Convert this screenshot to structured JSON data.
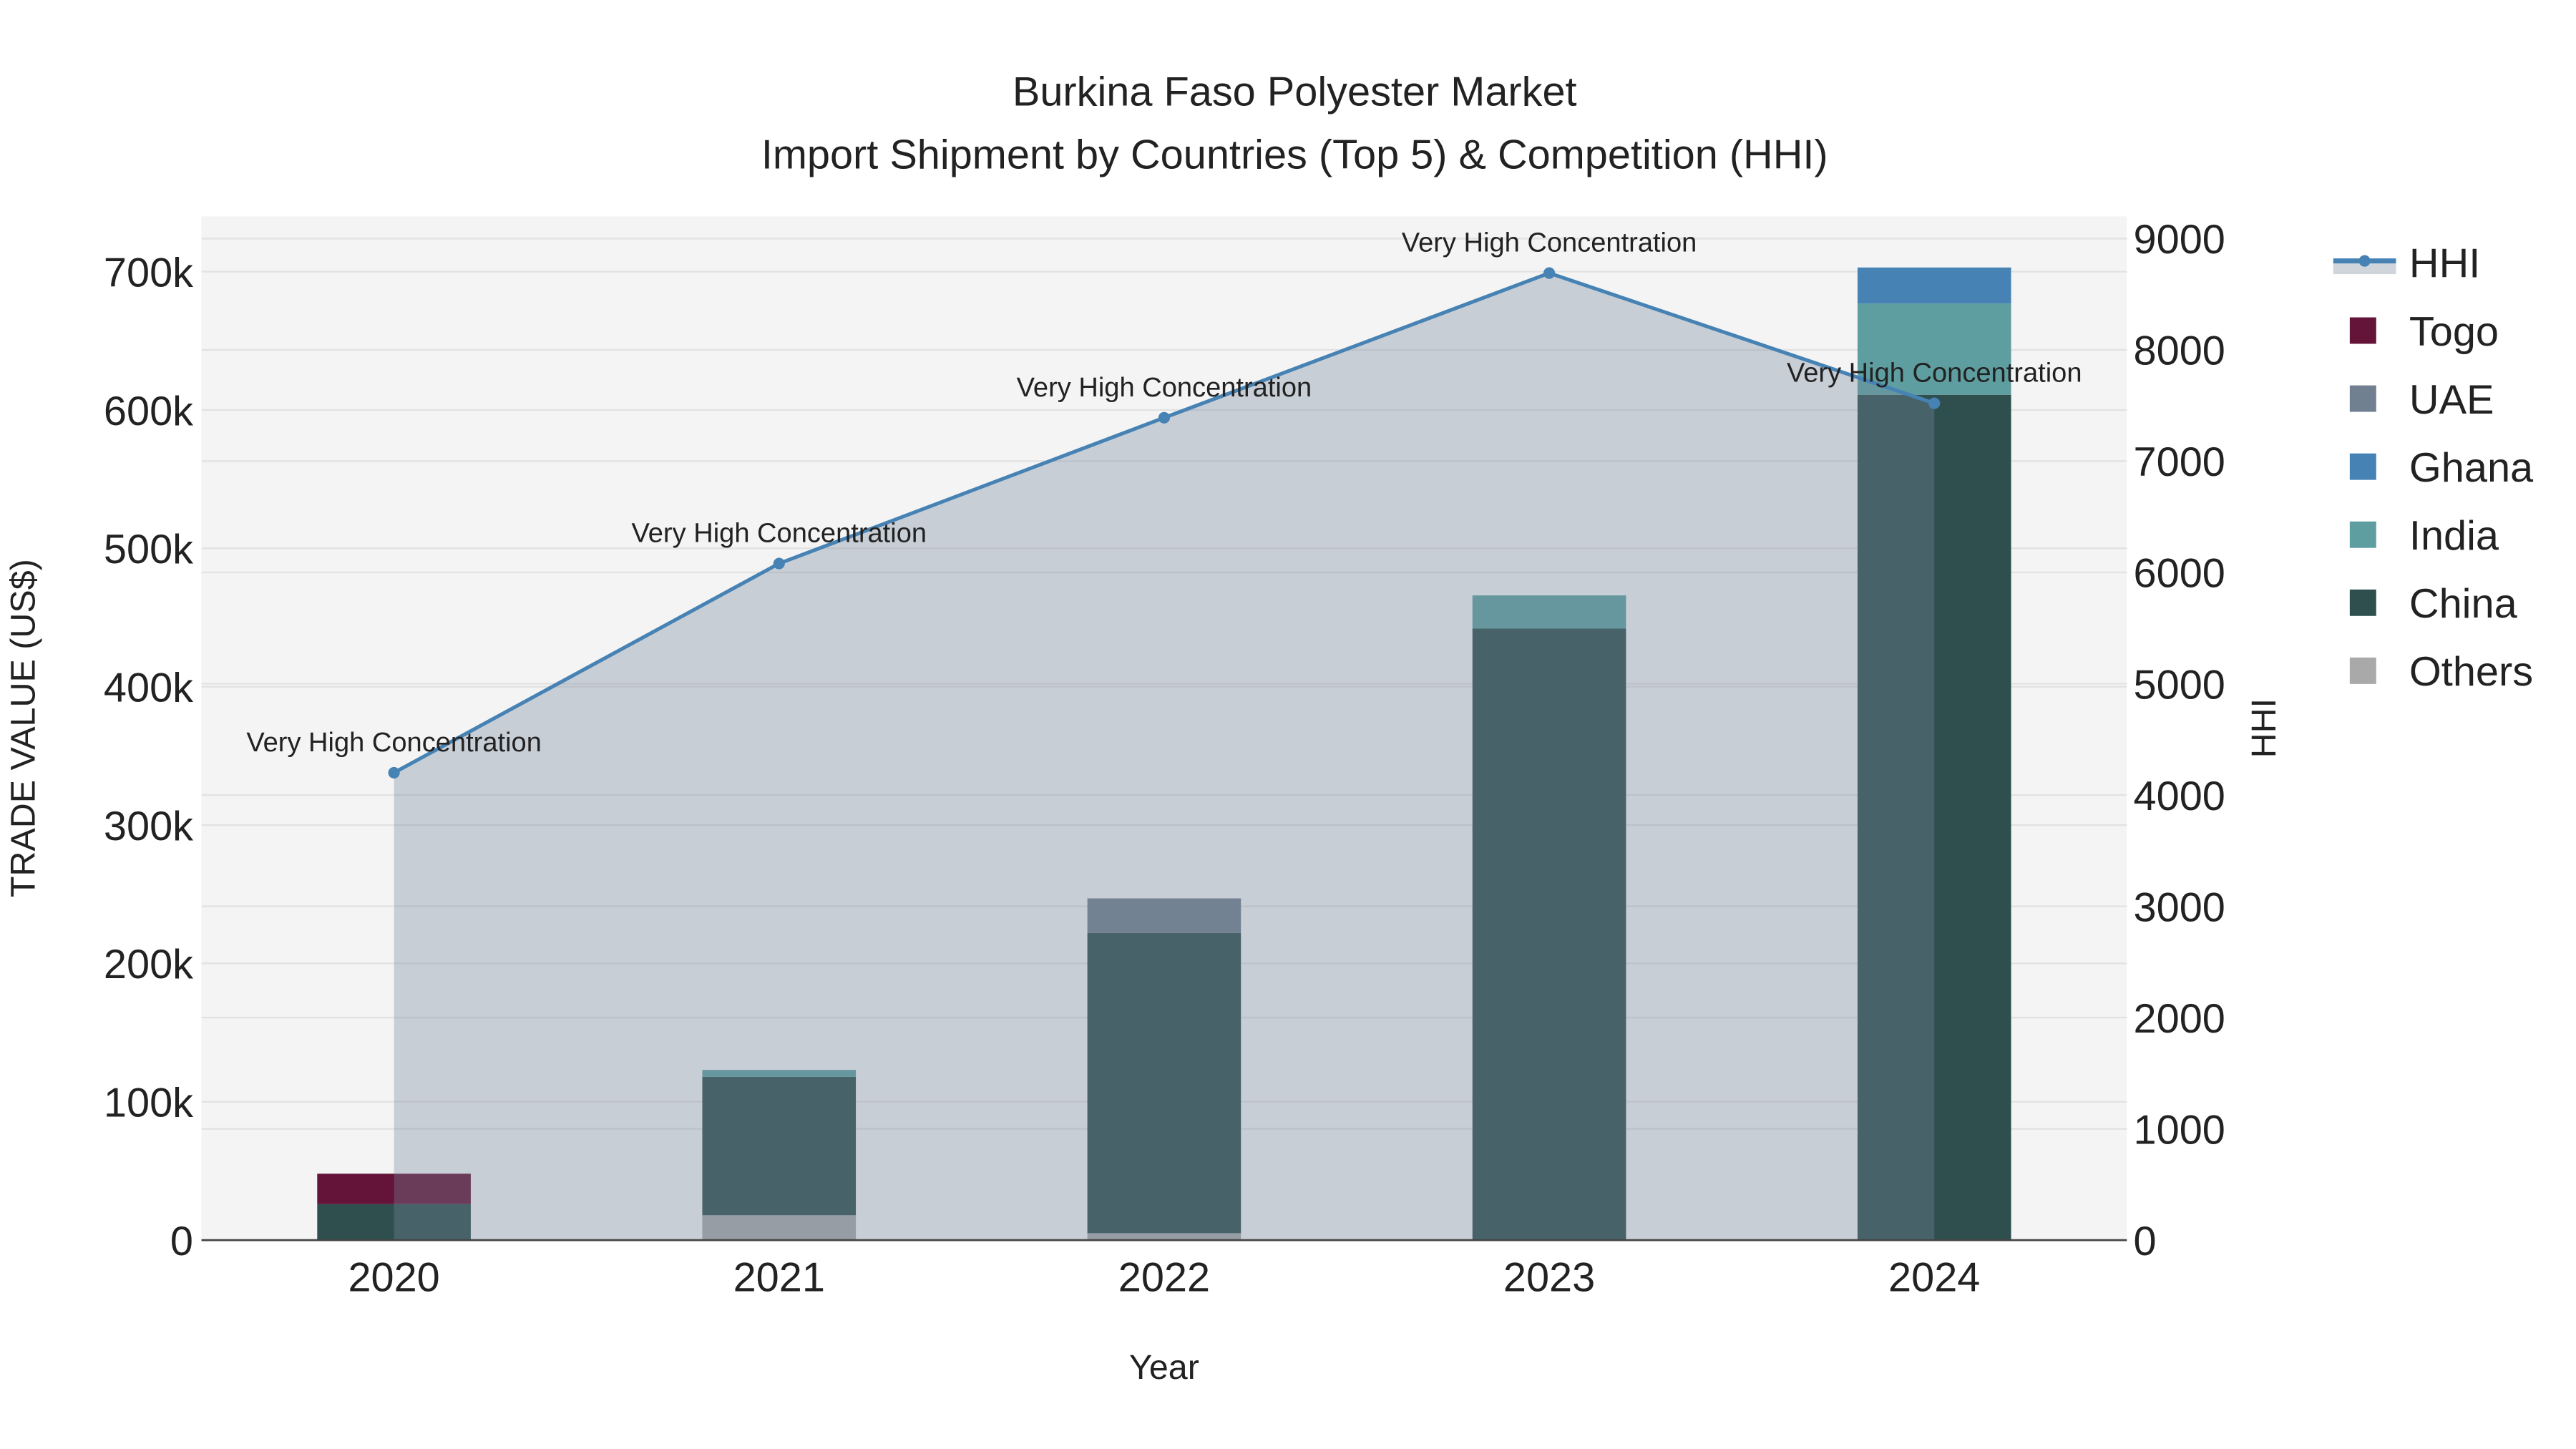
{
  "chart_data": {
    "type": "bar",
    "title": "Burkina Faso Polyester Market",
    "subtitle": "Import Shipment by Countries (Top 5) & Competition (HHI)",
    "xlabel": "Year",
    "ylabel": "TRADE VALUE (US$)",
    "y2label": "HHI",
    "categories": [
      "2020",
      "2021",
      "2022",
      "2023",
      "2024"
    ],
    "ylim": [
      0,
      740000
    ],
    "y2lim": [
      0,
      9200
    ],
    "yticks": [
      0,
      100000,
      200000,
      300000,
      400000,
      500000,
      600000,
      700000
    ],
    "ytick_labels": [
      "0",
      "100k",
      "200k",
      "300k",
      "400k",
      "500k",
      "600k",
      "700k"
    ],
    "y2ticks": [
      0,
      1000,
      2000,
      3000,
      4000,
      5000,
      6000,
      7000,
      8000,
      9000
    ],
    "y2tick_labels": [
      "0",
      "1000",
      "2000",
      "3000",
      "4000",
      "5000",
      "6000",
      "7000",
      "8000",
      "9000"
    ],
    "stacked": true,
    "series": [
      {
        "name": "Others",
        "color": "#a9a9a9",
        "values": [
          0,
          18000,
          5000,
          0,
          0
        ]
      },
      {
        "name": "China",
        "color": "#2f4f4f",
        "values": [
          26000,
          100000,
          217000,
          442000,
          611000
        ]
      },
      {
        "name": "India",
        "color": "#5f9ea0",
        "values": [
          0,
          5000,
          0,
          24000,
          66000
        ]
      },
      {
        "name": "Ghana",
        "color": "#4682b4",
        "values": [
          0,
          0,
          0,
          0,
          26000
        ]
      },
      {
        "name": "UAE",
        "color": "#708090",
        "values": [
          0,
          0,
          25000,
          0,
          0
        ]
      },
      {
        "name": "Togo",
        "color": "#641438",
        "values": [
          22000,
          0,
          0,
          0,
          0
        ]
      }
    ],
    "line": {
      "name": "HHI",
      "color": "#4682b4",
      "axis": "right",
      "values": [
        4200,
        6080,
        7390,
        8690,
        7520
      ],
      "annotations": [
        "Very High Concentration",
        "Very High Concentration",
        "Very High Concentration",
        "Very High Concentration",
        "Very High Concentration"
      ]
    },
    "legend": [
      "HHI",
      "Togo",
      "UAE",
      "Ghana",
      "India",
      "China",
      "Others"
    ],
    "legend_position": "right",
    "grid": true
  }
}
